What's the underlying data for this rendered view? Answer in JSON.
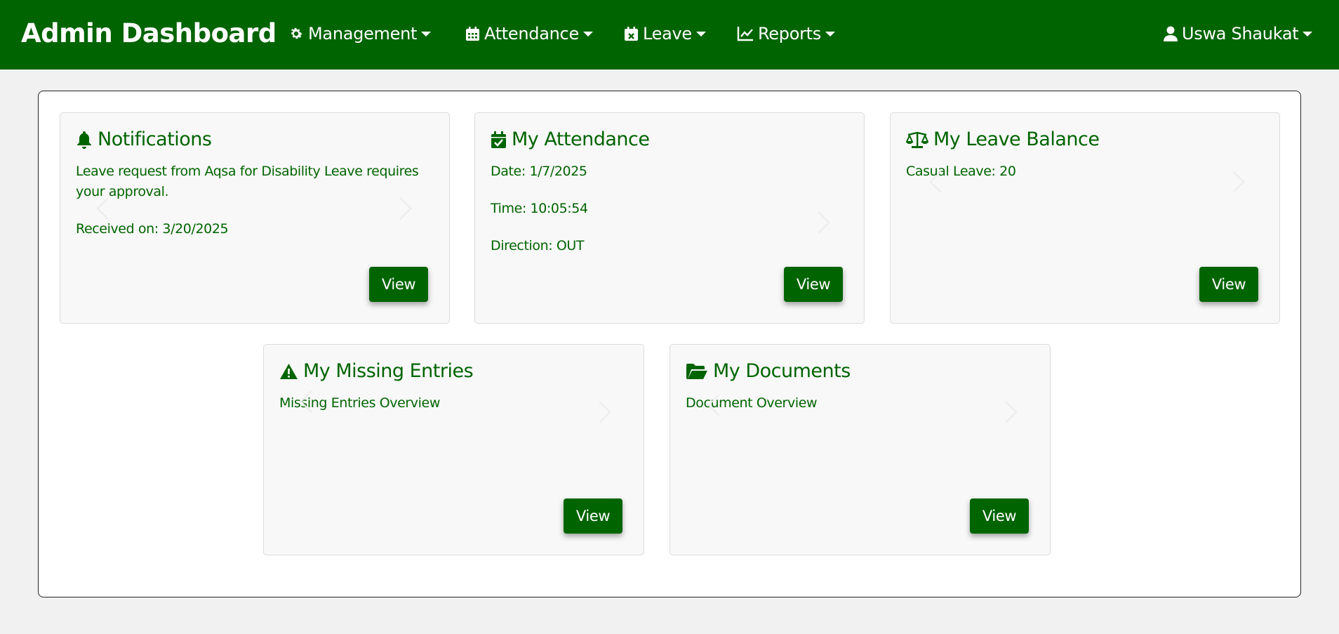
{
  "navbar": {
    "brand": "Admin Dashboard",
    "items": [
      {
        "label": "Management",
        "icon": "gear-icon"
      },
      {
        "label": "Attendance",
        "icon": "calendar-icon"
      },
      {
        "label": "Leave",
        "icon": "calendar-x-icon"
      },
      {
        "label": "Reports",
        "icon": "line-chart-icon"
      }
    ],
    "user": {
      "label": "Uswa Shaukat",
      "icon": "user-icon"
    }
  },
  "cards": {
    "notifications": {
      "title": "Notifications",
      "icon": "bell-icon",
      "message": "Leave request from Aqsa for Disability Leave requires your approval.",
      "received": "Received on: 3/20/2025",
      "button": "View"
    },
    "attendance": {
      "title": "My Attendance",
      "icon": "calendar-check-icon",
      "date": "Date: 1/7/2025",
      "time": "Time: 10:05:54",
      "direction": "Direction: OUT",
      "button": "View"
    },
    "leave_balance": {
      "title": "My Leave Balance",
      "icon": "scale-balance-icon",
      "casual": "Casual Leave: 20",
      "button": "View"
    },
    "missing_entries": {
      "title": "My Missing Entries",
      "icon": "warning-icon",
      "text": "Missing Entries Overview",
      "button": "View"
    },
    "documents": {
      "title": "My Documents",
      "icon": "folder-open-icon",
      "text": "Document Overview",
      "button": "View"
    }
  },
  "colors": {
    "primary": "#006400",
    "background": "#f1f1f1",
    "card": "#f8f8f8"
  }
}
